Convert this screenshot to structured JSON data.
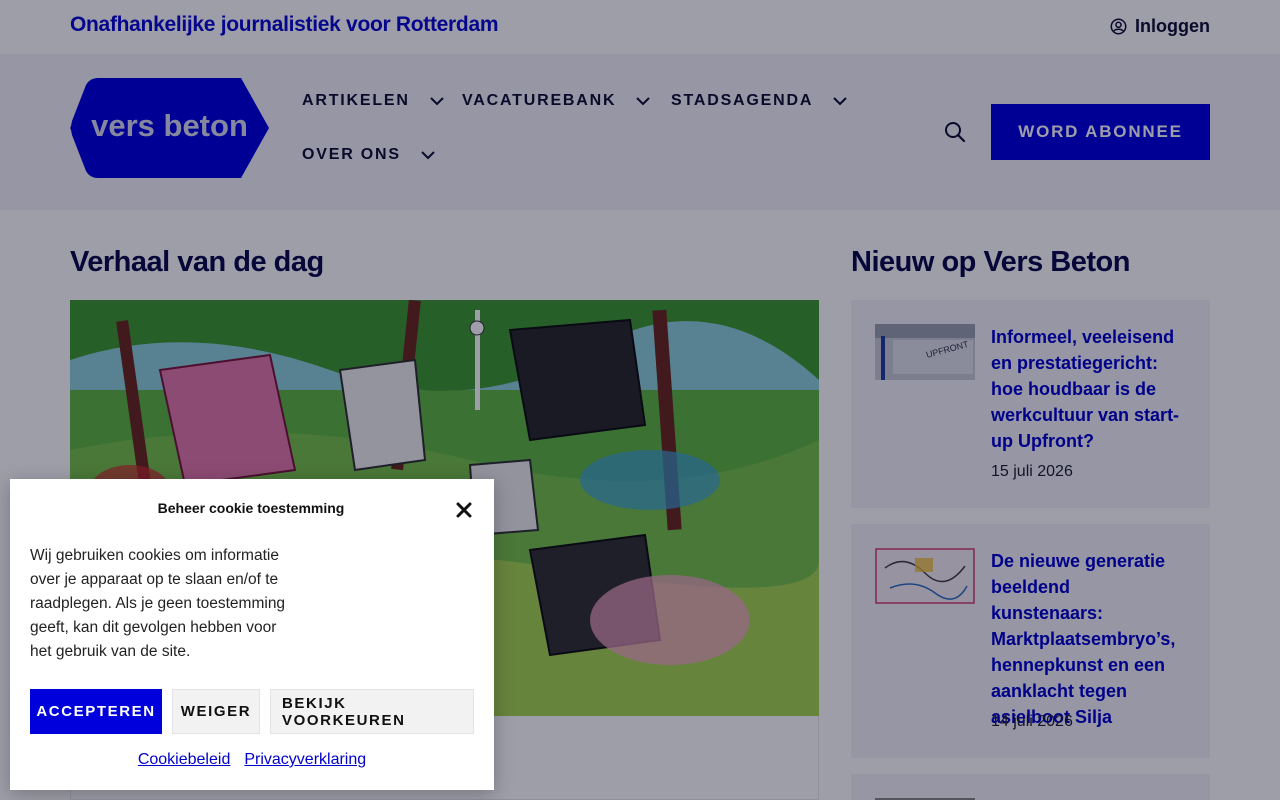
{
  "topbar": {
    "tagline": "Onafhankelijke journalistiek voor Rotterdam",
    "login_label": "Inloggen"
  },
  "header": {
    "logo_text": "vers beton",
    "nav": [
      {
        "label": "ARTIKELEN"
      },
      {
        "label": "VACATUREBANK"
      },
      {
        "label": "STADSAGENDA"
      },
      {
        "label": "OVER ONS"
      }
    ],
    "cta_label": "WORD ABONNEE"
  },
  "main": {
    "featured_heading": "Verhaal van de dag",
    "new_heading": "Nieuw op Vers Beton",
    "articles": [
      {
        "title": "Informeel, veeleisend en prestatiegericht: hoe houdbaar is de werkcultuur van start-up Upfront?",
        "date": "15 juli 2026"
      },
      {
        "title": "De nieuwe generatie beeldend kunstenaars: Marktplaatsembryo’s, hennepkunst en een aanklacht tegen asielboot Silja",
        "date": "14 juli 2026"
      }
    ]
  },
  "cookie": {
    "title": "Beheer cookie toestemming",
    "body": "Wij gebruiken cookies om informatie over je apparaat op te slaan en/of te raadplegen. Als je geen toestemming geeft, kan dit gevolgen hebben voor het gebruik van de site.",
    "accept_label": "ACCEPTEREN",
    "deny_label": "WEIGER",
    "prefs_label": "BEKIJK VOORKEUREN",
    "policy_link": "Cookiebeleid",
    "privacy_link": "Privacyverklaring"
  },
  "colors": {
    "brand_blue": "#0000dd",
    "overlay": "rgba(0,0,30,0.38)"
  }
}
